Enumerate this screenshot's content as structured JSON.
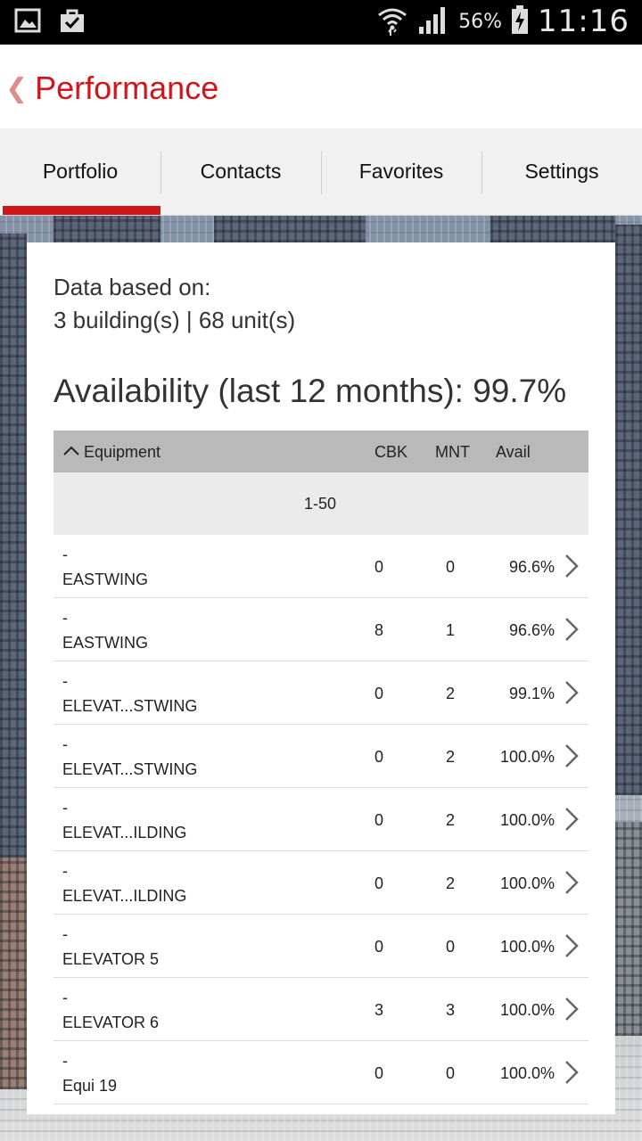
{
  "status_bar": {
    "battery_percent": "56%",
    "time": "11:16",
    "icons": [
      "gallery-icon",
      "bag-check-icon",
      "wifi-icon",
      "signal-icon",
      "battery-charging-icon"
    ]
  },
  "header": {
    "back_icon": "chevron-left-icon",
    "title": "Performance"
  },
  "tabs": [
    {
      "label": "Portfolio",
      "active": true
    },
    {
      "label": "Contacts",
      "active": false
    },
    {
      "label": "Favorites",
      "active": false
    },
    {
      "label": "Settings",
      "active": false
    }
  ],
  "summary": {
    "data_based_label": "Data based on:",
    "counts": "3 building(s) | 68 unit(s)",
    "availability": "Availability (last 12 months): 99.7%"
  },
  "table": {
    "headers": {
      "equipment": "Equipment",
      "cbk": "CBK",
      "mnt": "MNT",
      "avail": "Avail"
    },
    "range": "1-50",
    "rows": [
      {
        "prefix": "-",
        "name": "EASTWING",
        "cbk": "0",
        "mnt": "0",
        "avail": "96.6%"
      },
      {
        "prefix": "-",
        "name": "EASTWING",
        "cbk": "8",
        "mnt": "1",
        "avail": "96.6%"
      },
      {
        "prefix": "-",
        "name": "ELEVAT...STWING",
        "cbk": "0",
        "mnt": "2",
        "avail": "99.1%"
      },
      {
        "prefix": "-",
        "name": "ELEVAT...STWING",
        "cbk": "0",
        "mnt": "2",
        "avail": "100.0%"
      },
      {
        "prefix": "-",
        "name": "ELEVAT...ILDING",
        "cbk": "0",
        "mnt": "2",
        "avail": "100.0%"
      },
      {
        "prefix": "-",
        "name": "ELEVAT...ILDING",
        "cbk": "0",
        "mnt": "2",
        "avail": "100.0%"
      },
      {
        "prefix": "-",
        "name": "ELEVATOR 5",
        "cbk": "0",
        "mnt": "0",
        "avail": "100.0%"
      },
      {
        "prefix": "-",
        "name": "ELEVATOR 6",
        "cbk": "3",
        "mnt": "3",
        "avail": "100.0%"
      },
      {
        "prefix": "-",
        "name": "Equi 19",
        "cbk": "0",
        "mnt": "0",
        "avail": "100.0%"
      }
    ]
  },
  "colors": {
    "accent": "#d0161b",
    "tab_bg": "#f1f1f1",
    "table_header": "#b9b9b9",
    "range_bg": "#ebebeb"
  }
}
